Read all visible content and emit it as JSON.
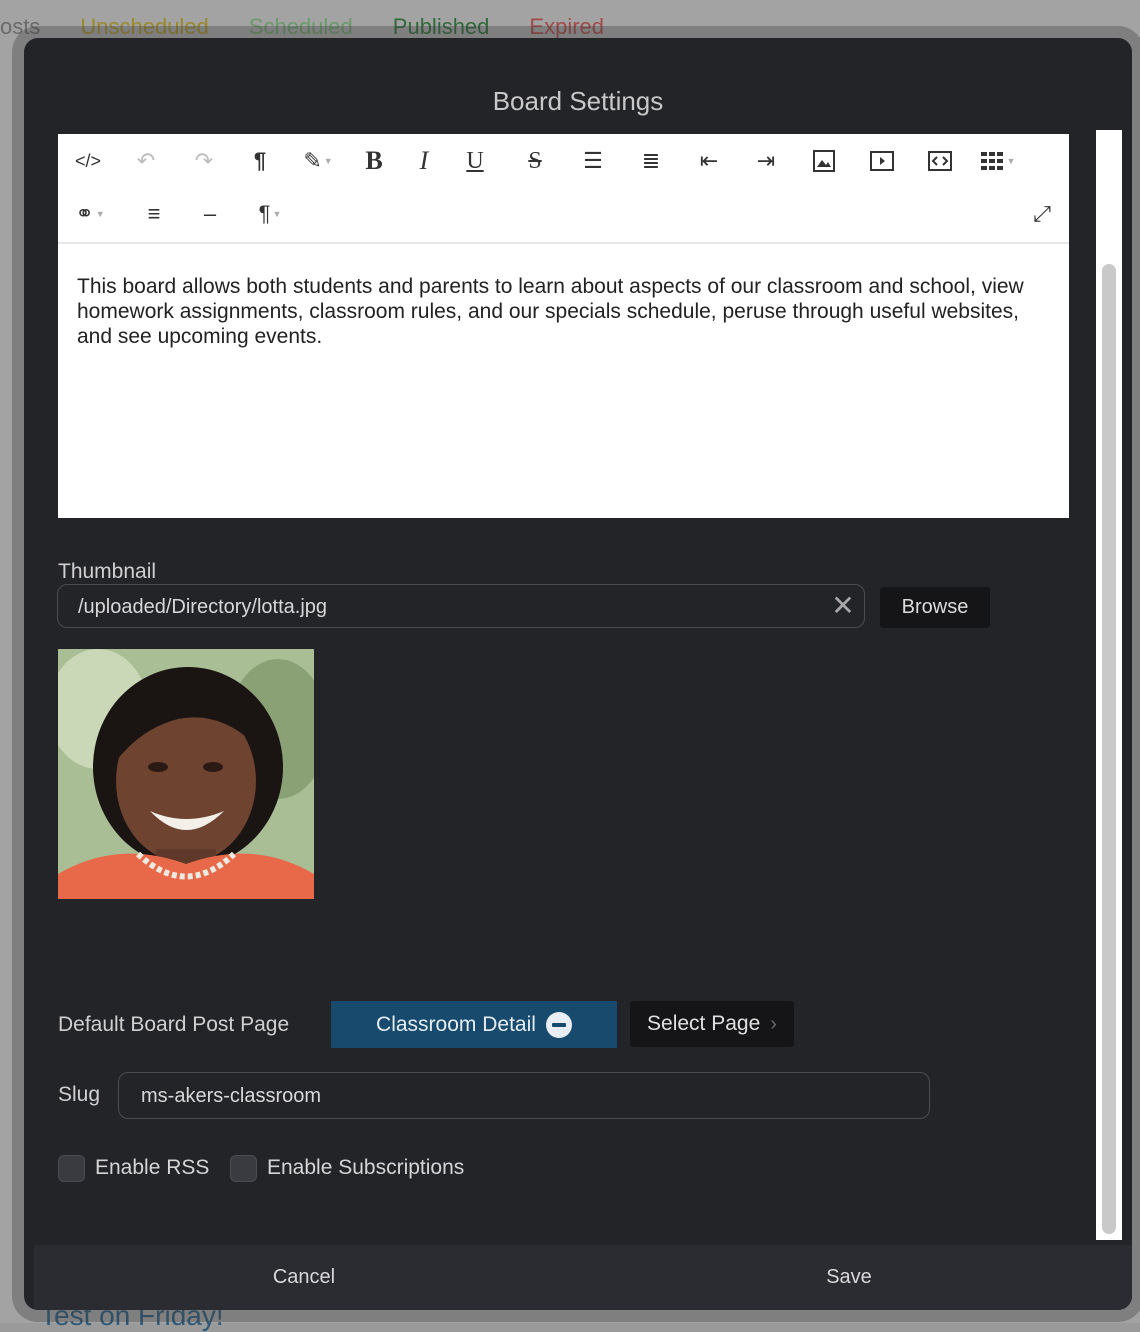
{
  "background": {
    "tabs": [
      {
        "label": "osts",
        "color": "#6b6b6b"
      },
      {
        "label": "Unscheduled",
        "color": "#9a8a2a"
      },
      {
        "label": "Scheduled",
        "color": "#6b9a6b"
      },
      {
        "label": "Published",
        "color": "#2f6b3a"
      },
      {
        "label": "Expired",
        "color": "#a34a4a"
      }
    ],
    "bottom_text": "Test on Friday!"
  },
  "modal": {
    "title": "Board Settings",
    "editor": {
      "toolbar_icons": [
        "code-view-icon",
        "undo-icon",
        "redo-icon",
        "paragraph-icon",
        "brush-icon",
        "bold-icon",
        "italic-icon",
        "underline-icon",
        "strikethrough-icon",
        "unordered-list-icon",
        "ordered-list-icon",
        "outdent-icon",
        "indent-icon",
        "image-icon",
        "video-icon",
        "embed-icon",
        "table-icon",
        "link-icon",
        "align-icon",
        "horizontal-rule-icon",
        "paragraph-format-icon",
        "fullscreen-icon"
      ],
      "body_text": "This board allows both students and parents to learn about aspects of our classroom and school, view homework assignments, classroom rules, and our specials schedule, peruse through useful websites, and see upcoming events."
    },
    "thumbnail": {
      "label": "Thumbnail",
      "value": "/uploaded/Directory/lotta.jpg",
      "browse_label": "Browse"
    },
    "default_page": {
      "label": "Default Board Post Page",
      "selected_label": "Classroom Detail",
      "select_label": "Select Page"
    },
    "slug": {
      "label": "Slug",
      "value": "ms-akers-classroom"
    },
    "options": {
      "rss_label": "Enable RSS",
      "subscriptions_label": "Enable Subscriptions"
    },
    "footer": {
      "cancel_label": "Cancel",
      "save_label": "Save"
    }
  },
  "colors": {
    "modal_bg": "#232428",
    "accent": "#184a6e"
  }
}
